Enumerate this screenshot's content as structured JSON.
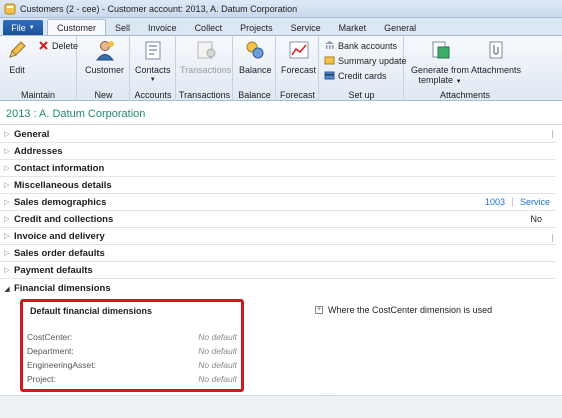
{
  "window": {
    "title": "Customers (2 - cee) - Customer account: 2013, A. Datum Corporation"
  },
  "ribbon_tabs": {
    "file": "File",
    "tabs": [
      {
        "label": "Customer",
        "active": true
      },
      {
        "label": "Sell"
      },
      {
        "label": "Invoice"
      },
      {
        "label": "Collect"
      },
      {
        "label": "Projects"
      },
      {
        "label": "Service"
      },
      {
        "label": "Market"
      },
      {
        "label": "General"
      }
    ]
  },
  "ribbon": {
    "maintain": {
      "label": "Maintain",
      "edit": "Edit",
      "delete": "Delete"
    },
    "new": {
      "label": "New",
      "customer": "Customer"
    },
    "accounts": {
      "label": "Accounts",
      "contacts": "Contacts"
    },
    "transactions": {
      "label": "Transactions",
      "transactions": "Transactions"
    },
    "balance": {
      "label": "Balance",
      "balance": "Balance"
    },
    "forecast": {
      "label": "Forecast",
      "forecast": "Forecast"
    },
    "setup": {
      "label": "Set up",
      "bank_accounts": "Bank accounts",
      "summary_update": "Summary update",
      "credit_cards": "Credit cards"
    },
    "attachments": {
      "label": "Attachments",
      "generate_line1": "Generate from",
      "generate_line2": "template",
      "attachments": "Attachments"
    }
  },
  "record": {
    "title": "2013 : A. Datum Corporation"
  },
  "fasttabs": [
    {
      "label": "General"
    },
    {
      "label": "Addresses"
    },
    {
      "label": "Contact information"
    },
    {
      "label": "Miscellaneous details"
    },
    {
      "label": "Sales demographics",
      "summary_link1": "1003",
      "summary_link2": "Service"
    },
    {
      "label": "Credit and collections",
      "summary_text": "No"
    },
    {
      "label": "Invoice and delivery"
    },
    {
      "label": "Sales order defaults"
    },
    {
      "label": "Payment defaults"
    },
    {
      "label": "Financial dimensions"
    }
  ],
  "financial_dimensions": {
    "heading": "Default financial dimensions",
    "rows": [
      {
        "label": "CostCenter:",
        "value": "No default"
      },
      {
        "label": "Department:",
        "value": "No default"
      },
      {
        "label": "EngineeringAsset:",
        "value": "No default"
      },
      {
        "label": "Project:",
        "value": "No default"
      }
    ],
    "where_used": "Where the CostCenter dimension is used"
  },
  "colors": {
    "accent": "#1f8a70",
    "link": "#1f6fc7",
    "highlight": "#d3161d",
    "file_tab": "#2f6fbf"
  }
}
